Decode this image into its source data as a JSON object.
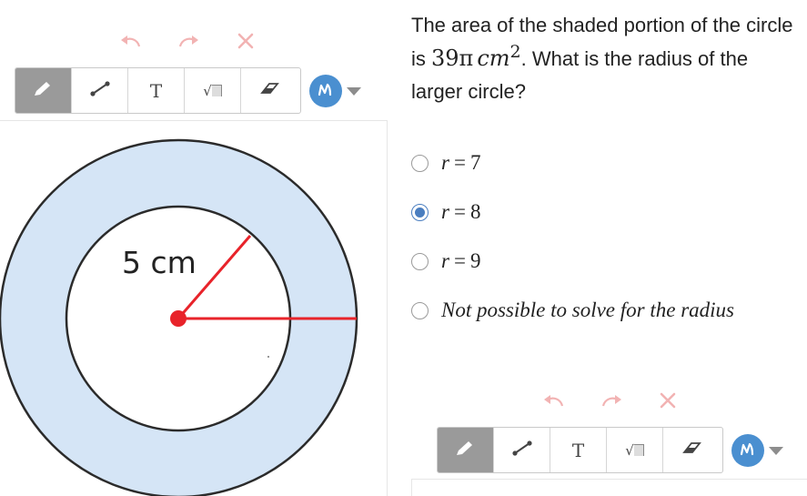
{
  "question": {
    "prefix": "The area of the shaded portion of the circle is",
    "area_value": "39π",
    "area_unit": "cm",
    "area_exponent": "2",
    "suffix": ". What is the radius of the larger circle?"
  },
  "choices": [
    {
      "var": "r",
      "op": "=",
      "value": "7",
      "selected": false
    },
    {
      "var": "r",
      "op": "=",
      "value": "8",
      "selected": true
    },
    {
      "var": "r",
      "op": "=",
      "value": "9",
      "selected": false
    },
    {
      "text": "Not possible to solve for the radius",
      "selected": false
    }
  ],
  "figure": {
    "inner_radius_label": "5 cm",
    "colors": {
      "shaded": "#d5e5f6",
      "outline": "#2b2b2b",
      "radius": "#e8232a"
    }
  },
  "top_toolbar": {
    "tools": [
      "pencil-icon",
      "line-icon",
      "T",
      "√",
      "eraser-icon"
    ],
    "active_tool": 0
  },
  "bottom_toolbar": {
    "tools": [
      "pencil-icon",
      "line-icon",
      "T",
      "√",
      "eraser-icon"
    ],
    "active_tool": 0
  },
  "colors": {
    "accent": "#4a8fd0",
    "radio": "#4a7ec0",
    "history_icons": "#f2b3b3"
  }
}
